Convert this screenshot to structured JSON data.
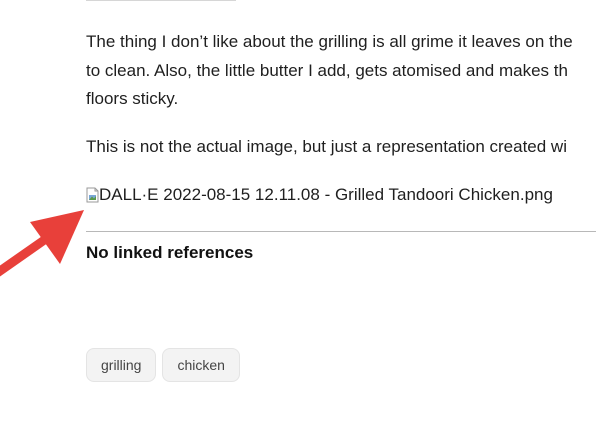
{
  "article": {
    "line_top_partial": "... ... ... ... ... ... ... ... ... ...",
    "paragraph_lines": [
      "The thing I don’t like about the grilling is all grime it leaves on the",
      "to clean. Also, the little butter I add, gets atomised and makes th",
      "floors sticky."
    ],
    "note_line": "This is not the actual image, but just a representation created wi",
    "image_alt": "DALL·E 2022-08-15 12.11.08 - Grilled Tandoori Chicken.png"
  },
  "references": {
    "heading": "No linked references"
  },
  "tags": [
    {
      "label": "grilling"
    },
    {
      "label": "chicken"
    }
  ],
  "annotation": {
    "arrow_color": "#e8403a"
  }
}
